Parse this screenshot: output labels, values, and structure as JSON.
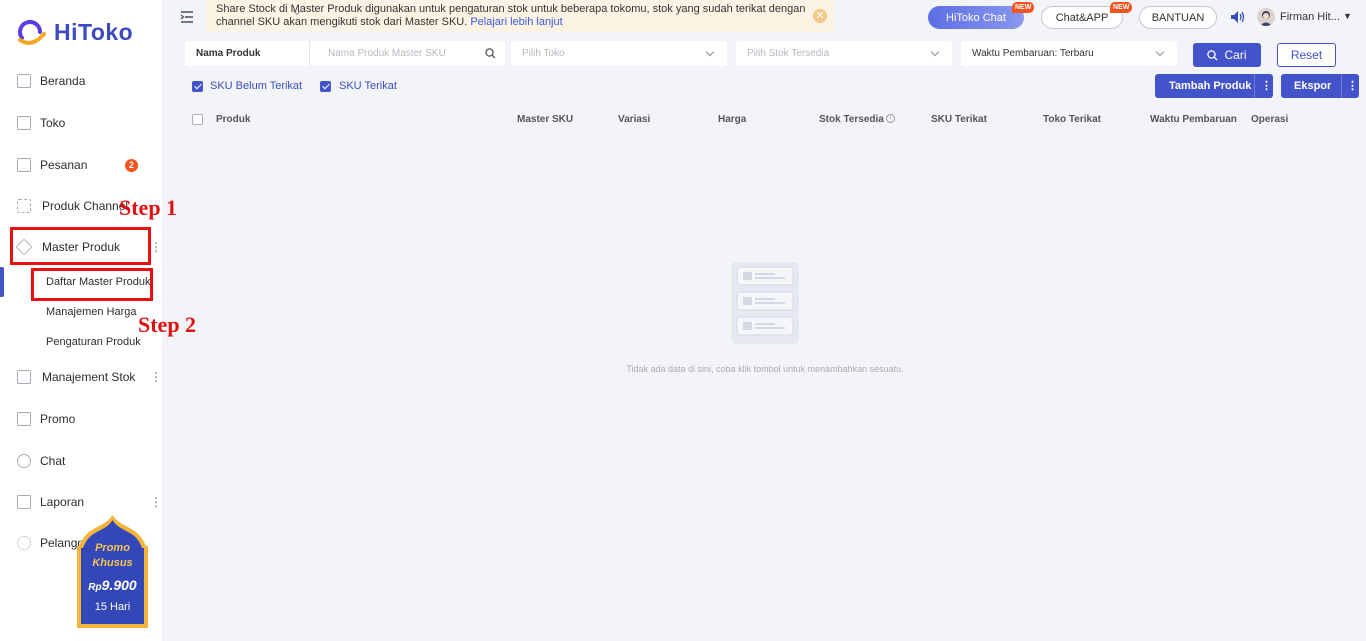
{
  "app": {
    "name": "HiToko"
  },
  "sidebar": {
    "items": [
      {
        "label": "Beranda"
      },
      {
        "label": "Toko"
      },
      {
        "label": "Pesanan",
        "badge": "2"
      },
      {
        "label": "Produk Channel"
      },
      {
        "label": "Master Produk"
      },
      {
        "label": "Manajement Stok"
      },
      {
        "label": "Promo"
      },
      {
        "label": "Chat"
      },
      {
        "label": "Laporan"
      },
      {
        "label": "Pelanggan"
      }
    ],
    "sub_items": [
      {
        "label": "Daftar Master Produk"
      },
      {
        "label": "Manajemen Harga"
      },
      {
        "label": "Pengaturan Produk"
      }
    ]
  },
  "annotations": {
    "step1": "Step 1",
    "step2": "Step 2"
  },
  "promo": {
    "line1": "Promo",
    "line2": "Khusus",
    "currency": "Rp",
    "price": "9.900",
    "duration": "15 Hari"
  },
  "topbar": {
    "notice_text": "Share Stock di Master Produk digunakan untuk pengaturan stok untuk beberapa tokomu, stok yang sudah terikat dengan channel SKU akan mengikuti stok dari Master SKU.",
    "notice_link": "Pelajari lebih lanjut",
    "chat_button": "HiToko Chat",
    "app_button": "Chat&APP",
    "help_button": "BANTUAN",
    "new_tag": "NEW",
    "user_name": "Firman Hit..."
  },
  "filters": {
    "search_type": "Nama Produk",
    "search_placeholder": "Nama Produk Master SKU",
    "store_placeholder": "Pilih Toko",
    "stock_placeholder": "Pilih Stok Tersedia",
    "sort_value": "Waktu Pembaruan: Terbaru",
    "search_button": "Cari",
    "reset_button": "Reset"
  },
  "toggles": {
    "unlinked": "SKU Belum Terikat",
    "linked": "SKU Terikat"
  },
  "actions": {
    "add_product": "Tambah Produk",
    "export": "Ekspor"
  },
  "table": {
    "columns": [
      "Produk",
      "Master SKU",
      "Variasi",
      "Harga",
      "Stok Tersedia",
      "SKU Terikat",
      "Toko Terikat",
      "Waktu Pembaruan",
      "Operasi"
    ],
    "empty_text": "Tidak ada data di sini, coba klik tombol untuk menambahkan sesuatu."
  },
  "colors": {
    "primary": "#4353c9",
    "annotation_red": "#e81010",
    "badge": "#f5531f"
  }
}
